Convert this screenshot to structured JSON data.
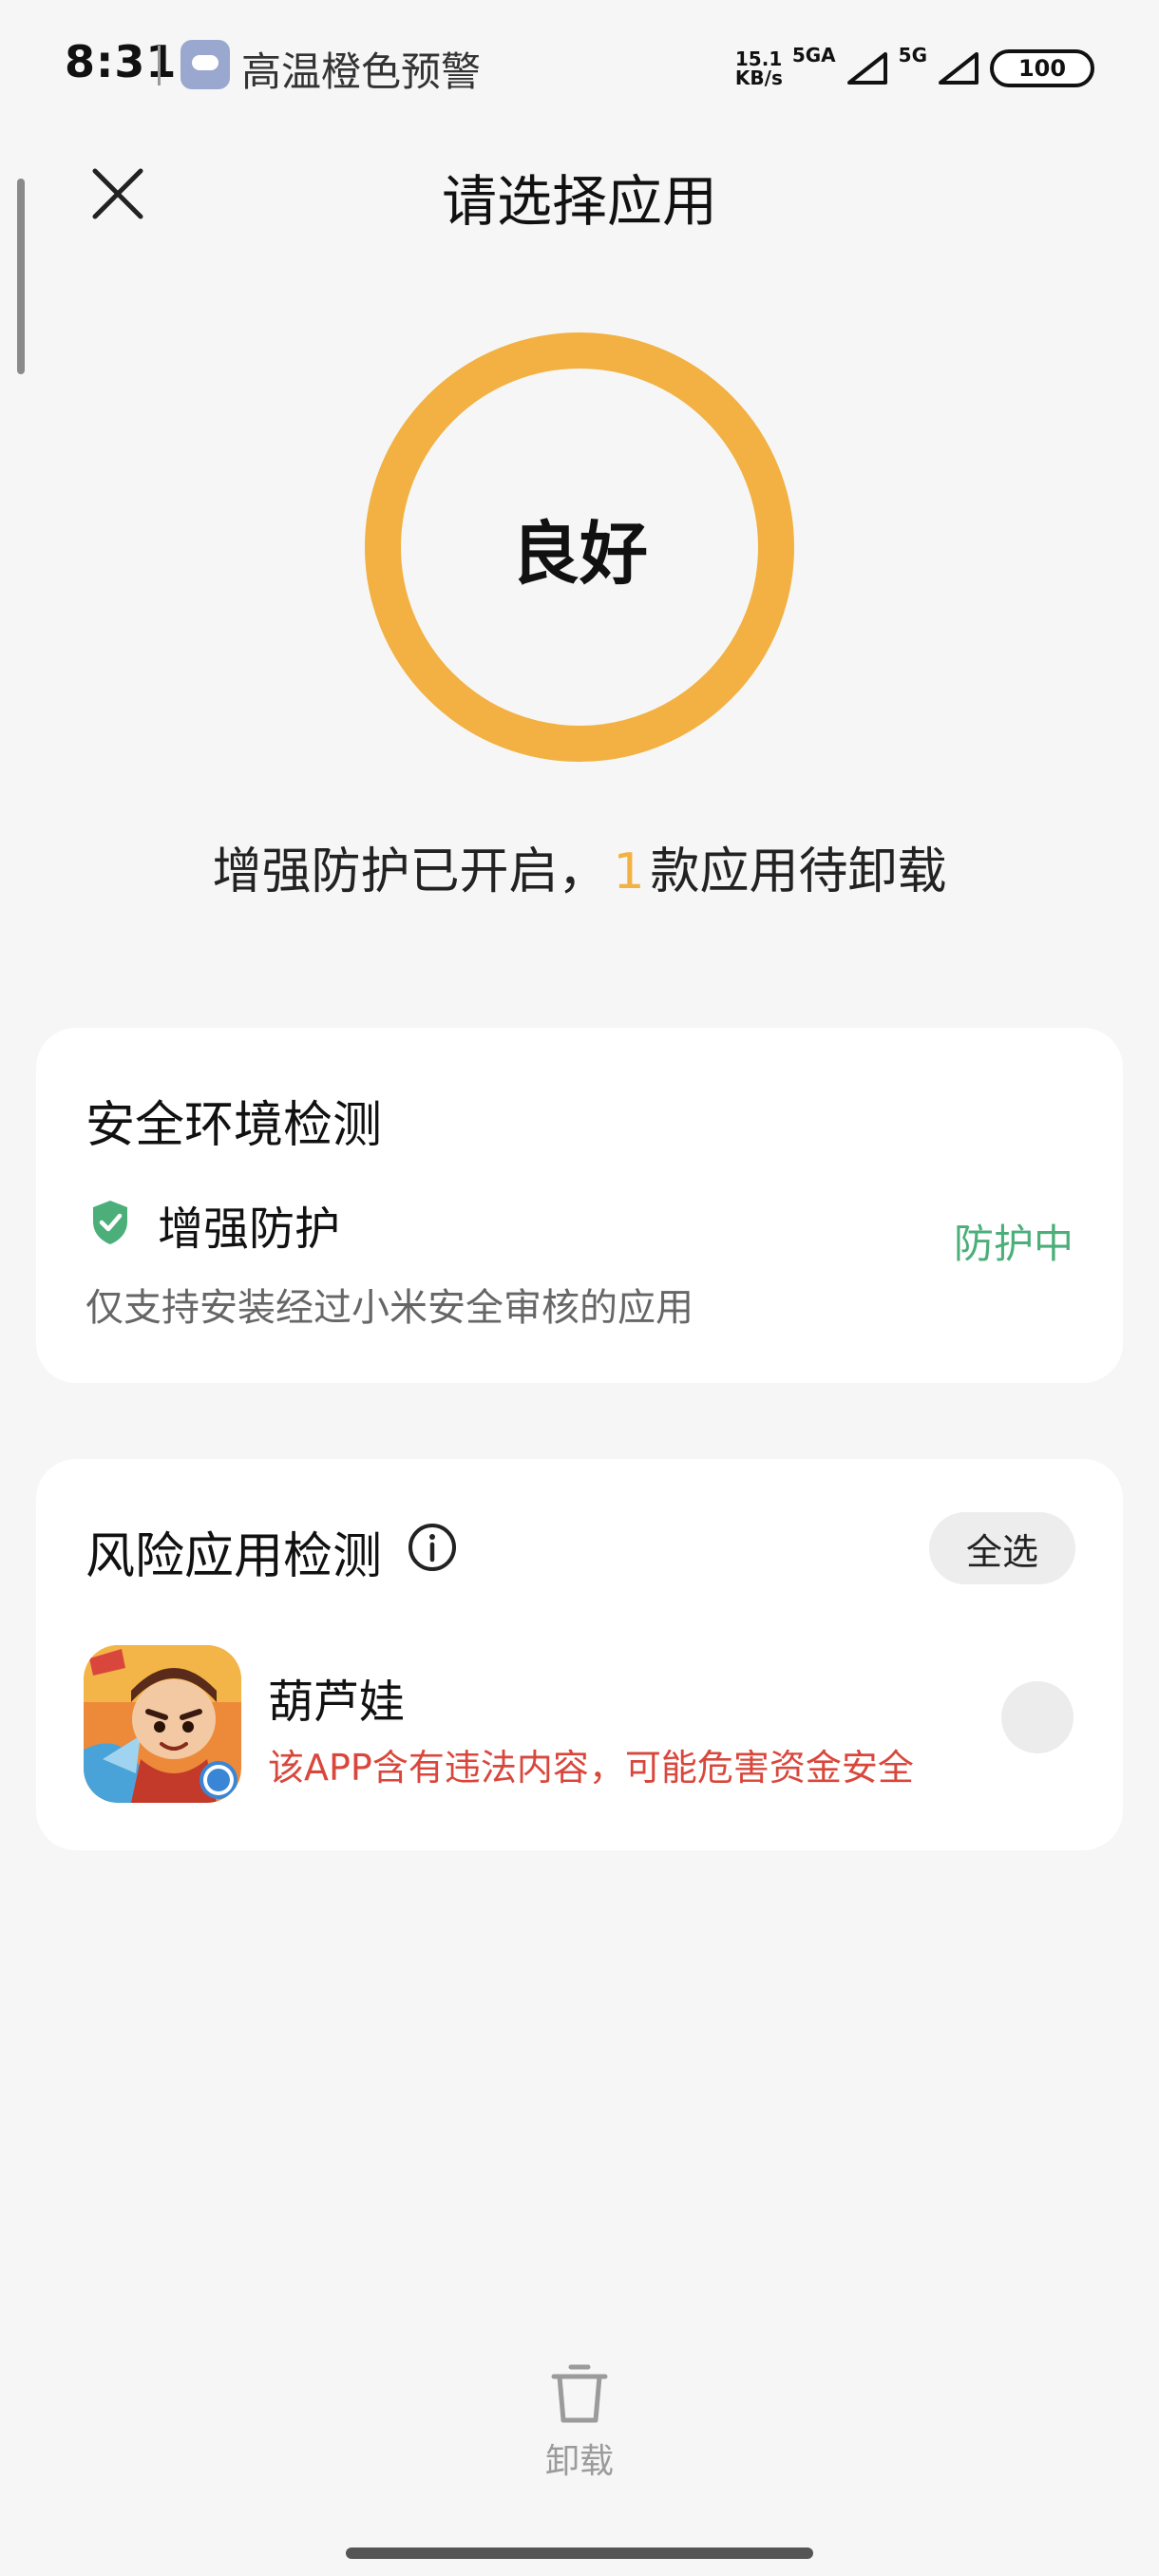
{
  "status_bar": {
    "time": "8:31",
    "alert_text": "高温橙色预警",
    "net_speed_value": "15.1",
    "net_speed_unit": "KB/s",
    "network_1": "5GA",
    "network_2": "5G",
    "battery": "100"
  },
  "header": {
    "title": "请选择应用",
    "close_icon": "close-icon"
  },
  "status": {
    "ring_text": "良好",
    "ring_color": "#f2b142",
    "summary_prefix": "增强防护已开启，",
    "summary_count": "1",
    "summary_suffix": "款应用待卸载"
  },
  "security_card": {
    "title": "安全环境检测",
    "feature_label": "增强防护",
    "feature_desc": "仅支持安装经过小米安全审核的应用",
    "feature_status": "防护中",
    "status_color": "#4caf7a"
  },
  "risk_card": {
    "title": "风险应用检测",
    "select_all": "全选",
    "apps": [
      {
        "name": "葫芦娃",
        "warning": "该APP含有违法内容，可能危害资金安全",
        "warning_color": "#d9473c"
      }
    ]
  },
  "bottom": {
    "uninstall_label": "卸载"
  }
}
